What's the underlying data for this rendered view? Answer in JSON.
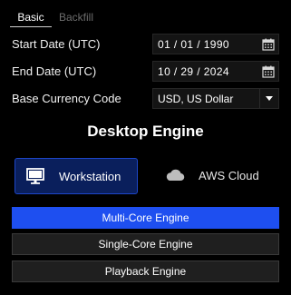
{
  "tabs": [
    {
      "label": "Basic",
      "active": true
    },
    {
      "label": "Backfill",
      "active": false
    }
  ],
  "form": {
    "start_date": {
      "label": "Start Date (UTC)",
      "value": "01 / 01 / 1990",
      "icon": "calendar-icon"
    },
    "end_date": {
      "label": "End Date (UTC)",
      "value": "10 / 29 / 2024",
      "icon": "calendar-icon"
    },
    "base_currency": {
      "label": "Base Currency Code",
      "value": "USD, US Dollar",
      "icon": "chevron-down-icon"
    }
  },
  "engine_section": {
    "title": "Desktop Engine",
    "modes": [
      {
        "label": "Workstation",
        "icon": "monitor-icon",
        "selected": true
      },
      {
        "label": "AWS Cloud",
        "icon": "cloud-icon",
        "selected": false
      }
    ],
    "engines": [
      {
        "label": "Multi-Core Engine",
        "active": true
      },
      {
        "label": "Single-Core Engine",
        "active": false
      },
      {
        "label": "Playback Engine",
        "active": false
      }
    ]
  },
  "colors": {
    "background": "#000000",
    "accent": "#1e4ff0",
    "selected_mode_bg": "#0a1f5c",
    "inactive_button_bg": "#1f1f1f"
  }
}
